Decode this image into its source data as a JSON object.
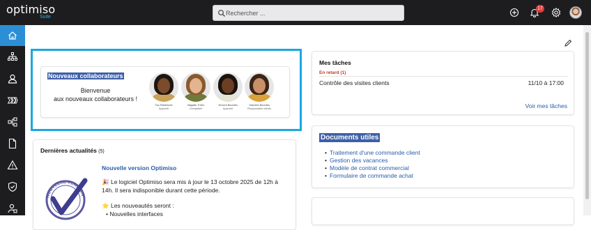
{
  "app": {
    "logo_text": "optimiso",
    "logo_sub": "Suite",
    "accent": "#2c8fd6",
    "highlight": "#1aa7e0"
  },
  "topbar": {
    "search_placeholder": "Rechercher ...",
    "notifications_count": "17",
    "icons": [
      "plus-circle-icon",
      "bell-icon",
      "gear-icon",
      "avatar"
    ]
  },
  "sidebar": {
    "items": [
      "home-icon",
      "org-chart-icon",
      "user-icon",
      "process-icon",
      "structure-icon",
      "document-icon",
      "warning-icon",
      "shield-icon",
      "user-settings-icon"
    ],
    "active": "home-icon"
  },
  "welcome": {
    "title": "Nouveaux collaborateurs",
    "text_line1": "Bienvenue",
    "text_line2": "aux nouveaux collaborateurs !",
    "people": [
      {
        "name": "Tao Rabbinord",
        "role": "Apprenti"
      },
      {
        "name": "Magalie Trebo",
        "role": "Comptable"
      },
      {
        "name": "Vincent Bourdes",
        "role": "Apprenti"
      },
      {
        "name": "Yasmine Bourdes",
        "role": "Responsable clients"
      }
    ]
  },
  "tasks": {
    "title": "Mes tâches",
    "late_label": "En retard",
    "late_count": "(1)",
    "items": [
      {
        "name": "Contrôle des visites clients",
        "date": "11/10 à 17:00"
      }
    ],
    "link": "Voir mes tâches"
  },
  "documents": {
    "title": "Documents utiles",
    "items": [
      "Traitement d'une commande client",
      "Gestion des vacances",
      "Modèle de contrat commercial",
      "Formulaire de commande achat"
    ]
  },
  "news": {
    "title": "Dernières actualités",
    "count": "(5)",
    "stamp_text": "NOUVELLE VERSION",
    "headline": "Nouvelle version Optimiso",
    "body_icon": "🎉",
    "body": "Le logiciel Optimiso sera mis à jour le 13 octobre 2025 de 12h à 14h. Il sera indisponible durant cette période.",
    "sub_icon": "⭐",
    "sub": "Les nouveautés seront :",
    "bullet": "• Nouvelles interfaces"
  }
}
